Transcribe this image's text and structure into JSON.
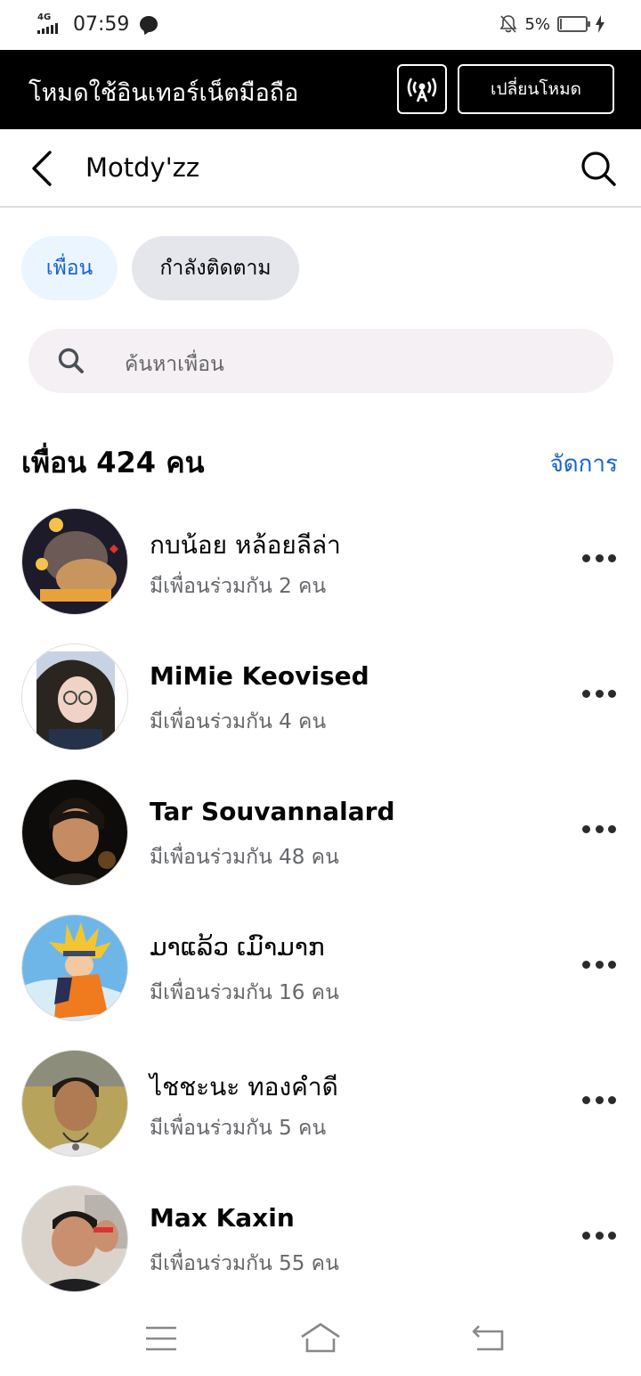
{
  "status_bar": {
    "network": "4G",
    "time": "07:59",
    "battery": "5%"
  },
  "data_mode": {
    "title": "โหมดใช้อินเทอร์เน็ตมือถือ",
    "switch_label": "เปลี่ยนโหมด"
  },
  "header": {
    "title": "Motdy'zz"
  },
  "tabs": [
    {
      "label": "เพื่อน",
      "active": true
    },
    {
      "label": "กำลังติดตาม",
      "active": false
    }
  ],
  "search": {
    "placeholder": "ค้นหาเพื่อน"
  },
  "friends_section": {
    "count_label": "เพื่อน 424 คน",
    "manage_label": "จัดการ"
  },
  "friends": [
    {
      "name": "กบน้อย หล้อยลีล่า",
      "mutual": "มีเพื่อนร่วมกัน 2 คน"
    },
    {
      "name": "MiMie Keovised",
      "mutual": "มีเพื่อนร่วมกัน 4 คน"
    },
    {
      "name": "Tar Souvannalard",
      "mutual": "มีเพื่อนร่วมกัน 48 คน"
    },
    {
      "name": "ມາແລ້ວ ເມົາມາກ",
      "mutual": "มีเพื่อนร่วมกัน 16 คน"
    },
    {
      "name": "ไชชะนะ ทองคำดี",
      "mutual": "มีเพื่อนร่วมกัน 5 คน"
    },
    {
      "name": "Max Kaxin",
      "mutual": "มีเพื่อนร่วมกัน 55 คน"
    }
  ],
  "colors": {
    "accent": "#1763cf",
    "active_tab_bg": "#ebf5ff",
    "inactive_tab_bg": "#e4e6eb",
    "banner_bg": "#000000",
    "secondary_text": "#65676b"
  }
}
